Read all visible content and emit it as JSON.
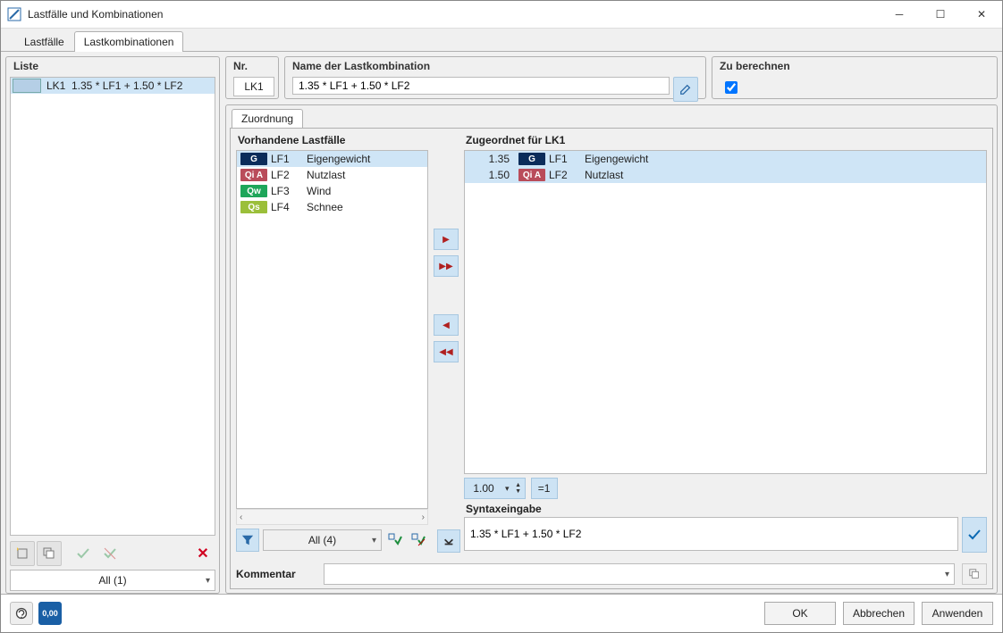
{
  "window": {
    "title": "Lastfälle und Kombinationen"
  },
  "tabs": {
    "lastfaelle": "Lastfälle",
    "kombis": "Lastkombinationen"
  },
  "liste": {
    "legend": "Liste",
    "items": [
      {
        "key": "LK1",
        "formula": "1.35 * LF1 + 1.50 * LF2"
      }
    ],
    "filter": "All (1)"
  },
  "nr": {
    "legend": "Nr.",
    "value": "LK1"
  },
  "name": {
    "legend": "Name der Lastkombination",
    "value": "1.35 * LF1 + 1.50 * LF2"
  },
  "berechnen": {
    "legend": "Zu berechnen",
    "checked": true
  },
  "zuordnung": {
    "tab": "Zuordnung",
    "available_legend": "Vorhandene Lastfälle",
    "assigned_legend": "Zugeordnet für LK1",
    "available": [
      {
        "badge": "G",
        "cls": "b-g",
        "key": "LF1",
        "desc": "Eigengewicht"
      },
      {
        "badge": "Qi A",
        "cls": "b-qia",
        "key": "LF2",
        "desc": "Nutzlast"
      },
      {
        "badge": "Qw",
        "cls": "b-qw",
        "key": "LF3",
        "desc": "Wind"
      },
      {
        "badge": "Qs",
        "cls": "b-qs",
        "key": "LF4",
        "desc": "Schnee"
      }
    ],
    "assigned": [
      {
        "factor": "1.35",
        "badge": "G",
        "cls": "b-g",
        "key": "LF1",
        "desc": "Eigengewicht"
      },
      {
        "factor": "1.50",
        "badge": "Qi A",
        "cls": "b-qia",
        "key": "LF2",
        "desc": "Nutzlast"
      }
    ],
    "avail_filter": "All (4)",
    "factor_spin": "1.00",
    "eq_label": "=1",
    "syntax_label": "Syntaxeingabe",
    "syntax_value": "1.35 * LF1 + 1.50 * LF2"
  },
  "kommentar": {
    "label": "Kommentar",
    "value": ""
  },
  "footer": {
    "ok": "OK",
    "cancel": "Abbrechen",
    "apply": "Anwenden",
    "decimal_icon": "0,00"
  }
}
